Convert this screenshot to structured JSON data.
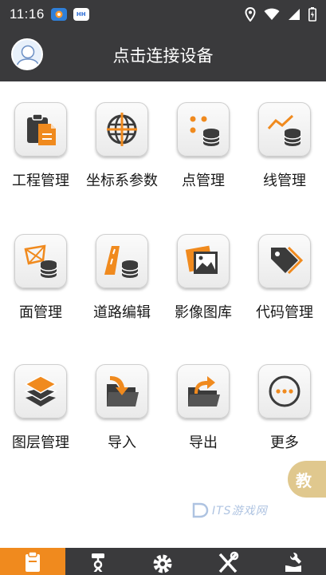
{
  "status_bar": {
    "time": "11:16",
    "app_icon_2_text": "HH"
  },
  "header": {
    "title": "点击连接设备"
  },
  "grid": [
    {
      "label": "工程管理",
      "icon": "clipboard-document-icon"
    },
    {
      "label": "坐标系参数",
      "icon": "globe-crosshair-icon"
    },
    {
      "label": "点管理",
      "icon": "points-database-icon"
    },
    {
      "label": "线管理",
      "icon": "line-database-icon"
    },
    {
      "label": "面管理",
      "icon": "surface-database-icon"
    },
    {
      "label": "道路编辑",
      "icon": "road-database-icon"
    },
    {
      "label": "影像图库",
      "icon": "image-gallery-icon"
    },
    {
      "label": "代码管理",
      "icon": "tag-code-icon"
    },
    {
      "label": "图层管理",
      "icon": "layers-icon"
    },
    {
      "label": "导入",
      "icon": "folder-import-icon"
    },
    {
      "label": "导出",
      "icon": "folder-export-icon"
    },
    {
      "label": "更多",
      "icon": "more-dots-icon"
    }
  ],
  "float_button": {
    "label": "教"
  },
  "watermark": {
    "text": "ITS游戏网"
  },
  "bottom_nav": [
    {
      "icon": "project-icon",
      "active": true
    },
    {
      "icon": "survey-instrument-icon",
      "active": false
    },
    {
      "icon": "settings-gear-icon",
      "active": false
    },
    {
      "icon": "tools-icon",
      "active": false
    },
    {
      "icon": "wrench-hand-icon",
      "active": false
    }
  ],
  "colors": {
    "accent": "#f08a1e",
    "bar_background": "#3a3a3c",
    "icon_dark": "#3b3b3b"
  }
}
